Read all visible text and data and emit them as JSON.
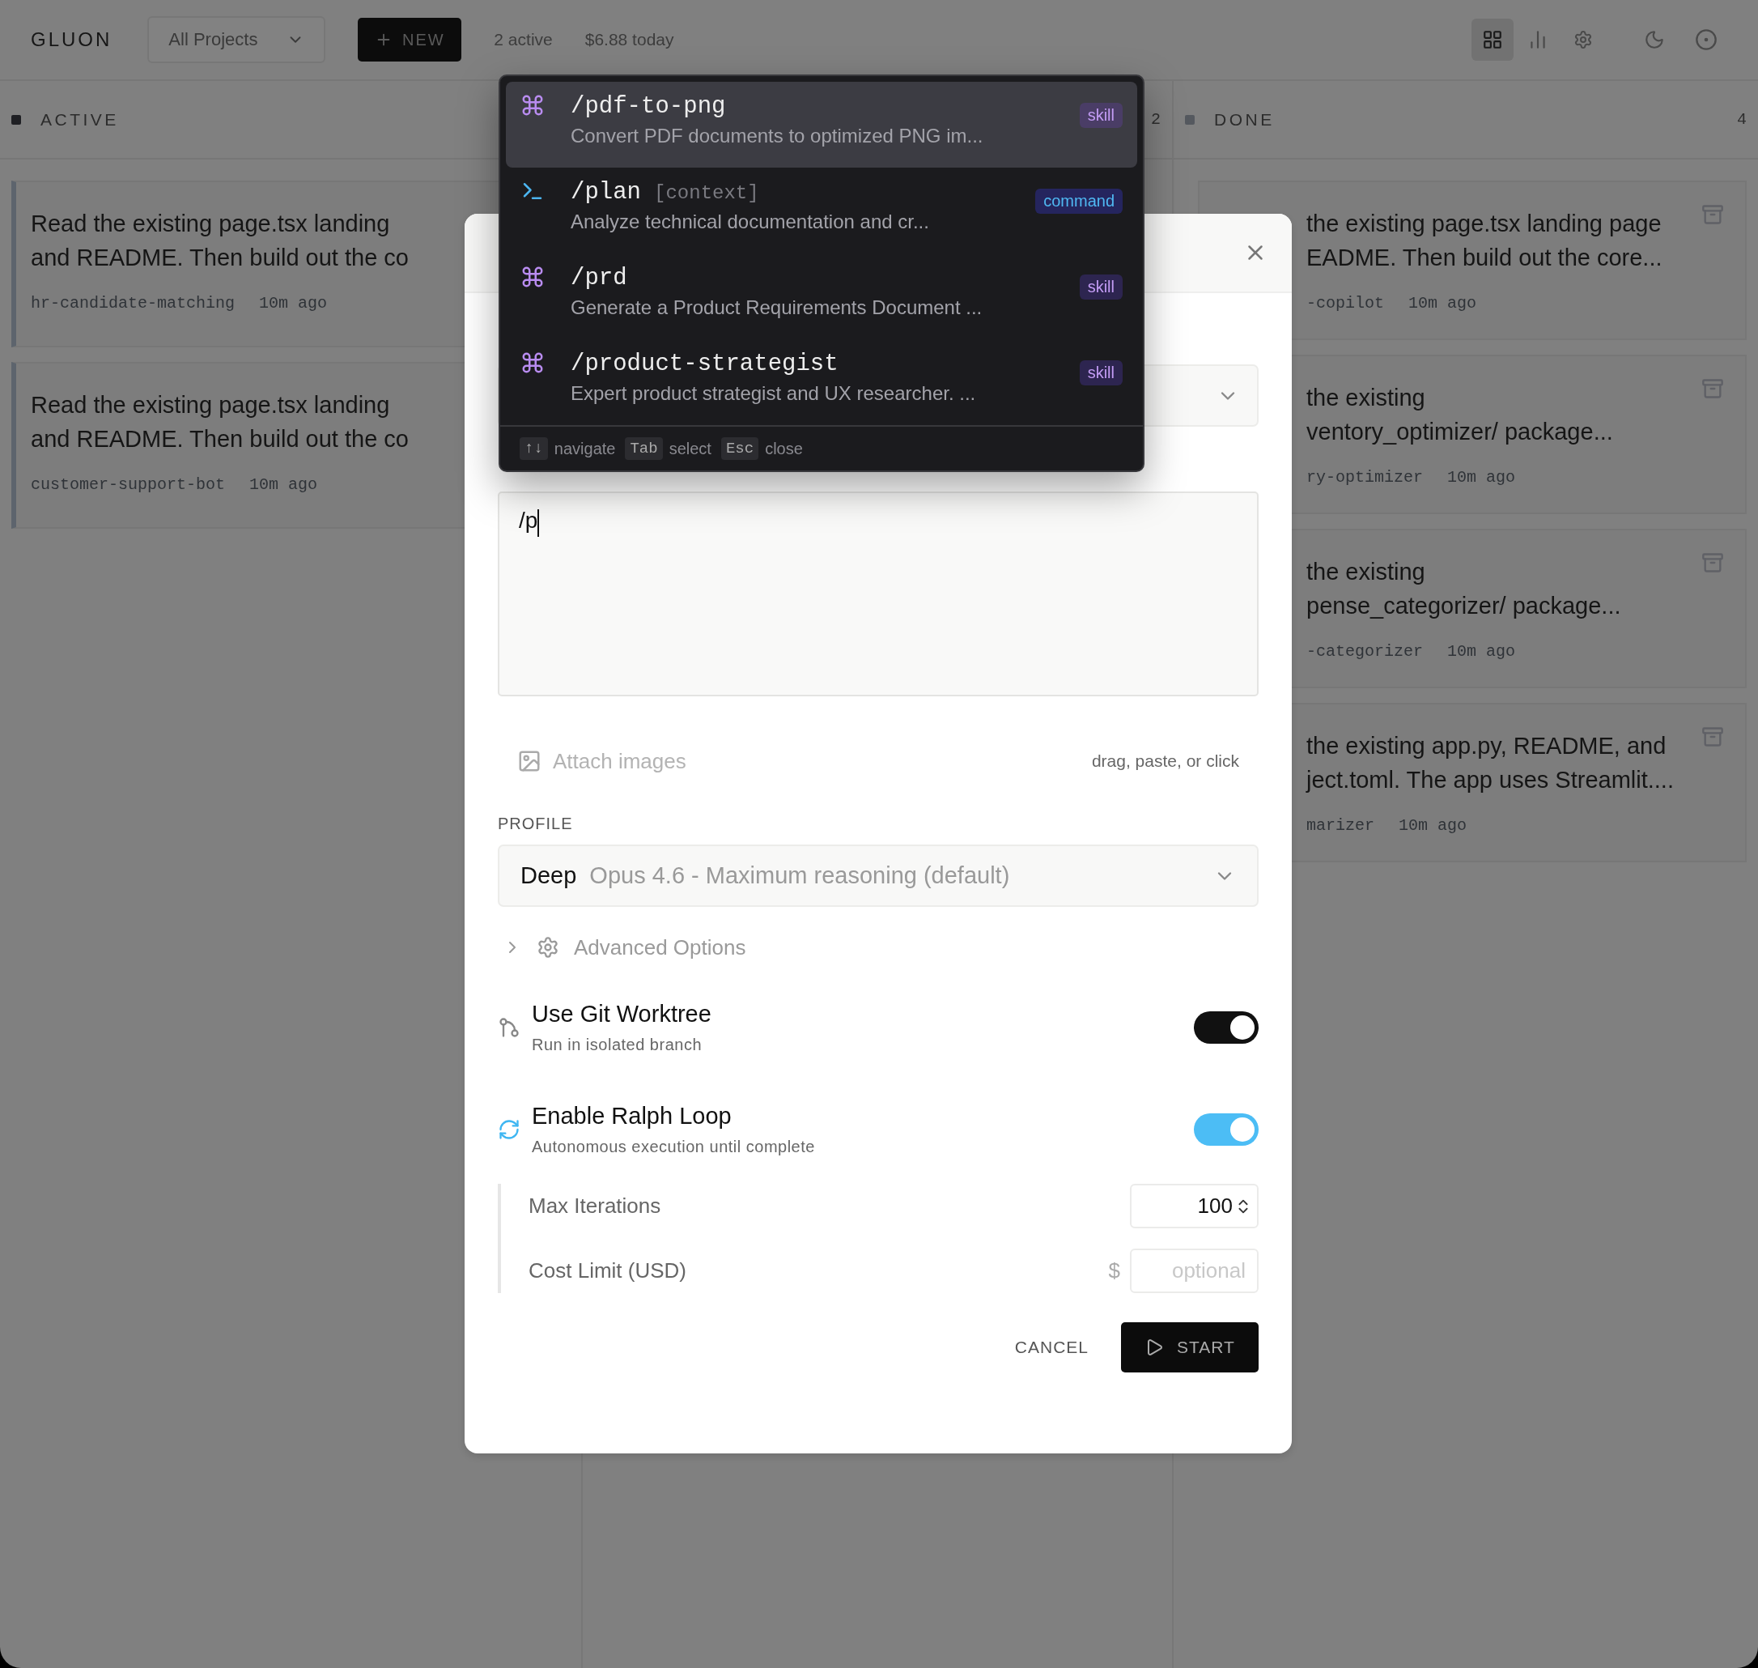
{
  "topbar": {
    "logo": "GLUON",
    "project_select": "All Projects",
    "new_button": "NEW",
    "active_count": "2 active",
    "cost_today": "$6.88 today",
    "views": [
      {
        "kind": "board",
        "selected": true
      },
      {
        "kind": "stats",
        "selected": false
      }
    ]
  },
  "columns": [
    {
      "title": "ACTIVE",
      "color": "#1f2024",
      "accent": true,
      "cards": [
        {
          "lines": [
            "Read the existing page.tsx landing",
            "and README. Then build out the co"
          ],
          "project": "hr-candidate-matching",
          "time": "10m ago"
        },
        {
          "lines": [
            "Read the existing page.tsx landing",
            "and README. Then build out the co"
          ],
          "project": "customer-support-bot",
          "time": "10m ago"
        }
      ]
    },
    {
      "count": "2"
    },
    {
      "title": "DONE",
      "color": "#55595f",
      "count": "4",
      "accent": false,
      "cards": [
        {
          "lines": [
            "the existing page.tsx landing page",
            "EADME. Then build out the core..."
          ],
          "project": "-copilot",
          "time": "10m ago"
        },
        {
          "lines": [
            "the existing",
            "ventory_optimizer/ package..."
          ],
          "project": "ry-optimizer",
          "time": "10m ago"
        },
        {
          "lines": [
            "the existing",
            "pense_categorizer/ package..."
          ],
          "project": "-categorizer",
          "time": "10m ago"
        },
        {
          "lines": [
            "the existing app.py, README, and",
            "ject.toml. The app uses Streamlit...."
          ],
          "project": "marizer",
          "time": "10m ago"
        }
      ]
    }
  ],
  "dialog": {
    "prompt": {
      "value": "/p"
    },
    "attach": {
      "label": "Attach images",
      "hint": "drag, paste, or click"
    },
    "profile": {
      "label": "PROFILE",
      "name": "Deep",
      "description": "Opus 4.6 - Maximum reasoning (default)"
    },
    "advanced": {
      "label": "Advanced Options",
      "expanded": false
    },
    "toggles": [
      {
        "kind": "git",
        "title": "Use Git Worktree",
        "subtitle": "Run in isolated branch",
        "on": true,
        "color": "#111111"
      },
      {
        "kind": "loop",
        "title": "Enable Ralph Loop",
        "subtitle": "Autonomous execution until complete",
        "on": true,
        "color": "#4cbdf5"
      }
    ],
    "max_iterations": {
      "label": "Max Iterations",
      "value": "100"
    },
    "cost_limit": {
      "label": "Cost Limit (USD)",
      "prefix": "$",
      "placeholder": "optional"
    },
    "cancel": "CANCEL",
    "start": "START"
  },
  "autocomplete": {
    "items": [
      {
        "kind": "skill",
        "command": "/pdf-to-png",
        "description": "Convert PDF documents to optimized PNG im...",
        "badge": "skill",
        "selected": true
      },
      {
        "kind": "command",
        "command": "/plan",
        "argument": "[context]",
        "description": "Analyze technical documentation and cr...",
        "badge": "command",
        "selected": false
      },
      {
        "kind": "skill",
        "command": "/prd",
        "description": "Generate a Product Requirements Document ...",
        "badge": "skill",
        "selected": false
      },
      {
        "kind": "skill",
        "command": "/product-strategist",
        "description": "Expert product strategist and UX researcher. ...",
        "badge": "skill",
        "selected": false
      }
    ],
    "footer": [
      {
        "key": "↑↓",
        "action": "navigate"
      },
      {
        "key": "Tab",
        "action": "select"
      },
      {
        "key": "Esc",
        "action": "close"
      }
    ]
  }
}
